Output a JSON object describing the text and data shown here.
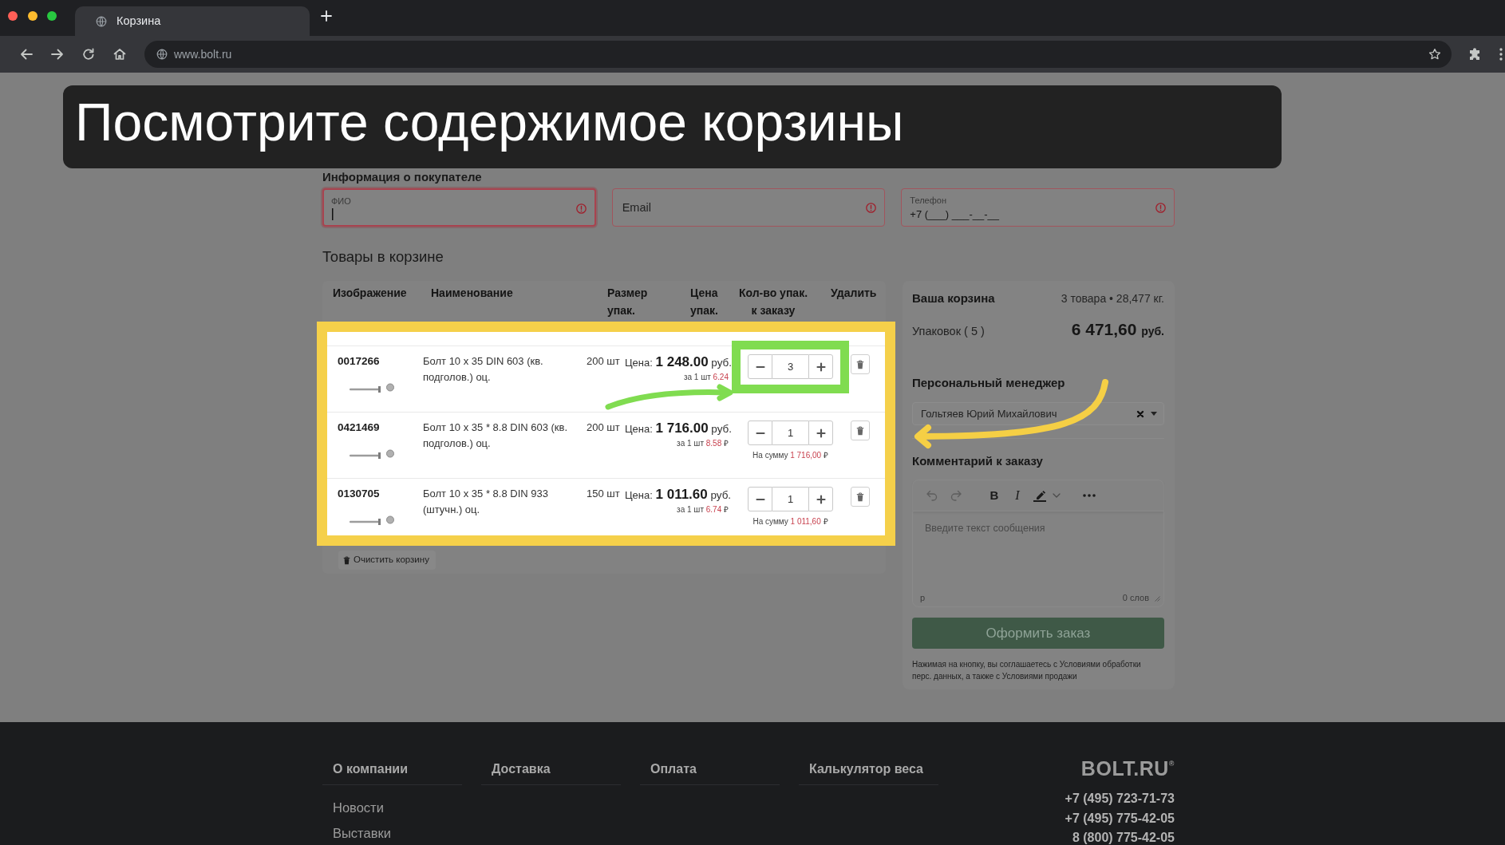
{
  "browser": {
    "tab_title": "Корзина",
    "url": "www.bolt.ru"
  },
  "banner": {
    "text": "Посмотрите содержимое корзины"
  },
  "buyer_info": {
    "title": "Информация о покупателе",
    "fields": [
      {
        "label": "ФИО",
        "focused": true,
        "invalid": true
      },
      {
        "placeholder": "Email",
        "focused": false,
        "invalid": true
      },
      {
        "label": "Телефон",
        "value": "+7 (___) ___-__-__",
        "focused": false,
        "invalid": true
      }
    ]
  },
  "cart": {
    "title": "Товары в корзине",
    "columns": [
      "Изображение",
      "Наименование",
      "Размер упак.",
      "Цена упак.",
      "Кол-во упак. к заказу",
      "Удалить"
    ],
    "rows": [
      {
        "code": "0017266",
        "name": "Болт 10 x 35 DIN 603 (кв. подголов.) оц.",
        "pack_size": "200 шт",
        "price_label": "Цена:",
        "price": "1 248.00",
        "price_currency": "руб.",
        "unit_label": "за 1 шт",
        "unit_price": "6.24",
        "quantity": "3"
      },
      {
        "code": "0421469",
        "name": "Болт 10 x 35 * 8.8 DIN 603 (кв. подголов.) оц.",
        "pack_size": "200 шт",
        "price_label": "Цена:",
        "price": "1 716.00",
        "price_currency": "руб.",
        "unit_label": "за 1 шт",
        "unit_price": "8.58",
        "unit_currency": "₽",
        "quantity": "1",
        "sum_label": "На сумму",
        "sum": "1 716,00",
        "sum_currency": "₽"
      },
      {
        "code": "0130705",
        "name": "Болт 10 x 35 * 8.8 DIN 933 (штучн.) оц.",
        "pack_size": "150 шт",
        "price_label": "Цена:",
        "price": "1 011.60",
        "price_currency": "руб.",
        "unit_label": "за 1 шт",
        "unit_price": "6.74",
        "unit_currency": "₽",
        "quantity": "1",
        "sum_label": "На сумму",
        "sum": "1 011,60",
        "sum_currency": "₽"
      }
    ],
    "clear_button": "Очистить корзину"
  },
  "summary": {
    "title": "Ваша корзина",
    "meta": "3 товара • 28,477 кг.",
    "packages": "Упаковок ( 5 )",
    "total": "6 471,60",
    "total_currency": "руб."
  },
  "manager": {
    "title": "Персональный менеджер",
    "selected": "Гольтяев Юрий Михайлович"
  },
  "comment": {
    "title": "Комментарий к заказу",
    "toolbar": [
      {
        "kind": "undo",
        "disabled": true
      },
      {
        "kind": "redo",
        "disabled": true
      },
      {
        "kind": "bold",
        "label": "B",
        "disabled": false
      },
      {
        "kind": "italic",
        "label": "I",
        "disabled": false
      },
      {
        "kind": "highlight",
        "disabled": false
      },
      {
        "kind": "more",
        "disabled": false
      }
    ],
    "placeholder": "Введите текст сообщения",
    "path": "p",
    "word_count": "0 слов"
  },
  "checkout": {
    "button": "Оформить заказ",
    "note": "Нажимая на кнопку, вы соглашаетесь с Условиями обработки перс. данных, а также с Условиями продажи"
  },
  "footer": {
    "columns": [
      {
        "title": "О компании",
        "links": [
          "Новости",
          "Выставки"
        ]
      },
      {
        "title": "Доставка"
      },
      {
        "title": "Оплата"
      },
      {
        "title": "Калькулятор веса"
      }
    ],
    "logo": "B**O**LT.RU$^{®}$",
    "phones": [
      "+7 (495) 723-71-73",
      "+7 (495) 775-42-05",
      "8 (800) 775-42-05"
    ]
  }
}
